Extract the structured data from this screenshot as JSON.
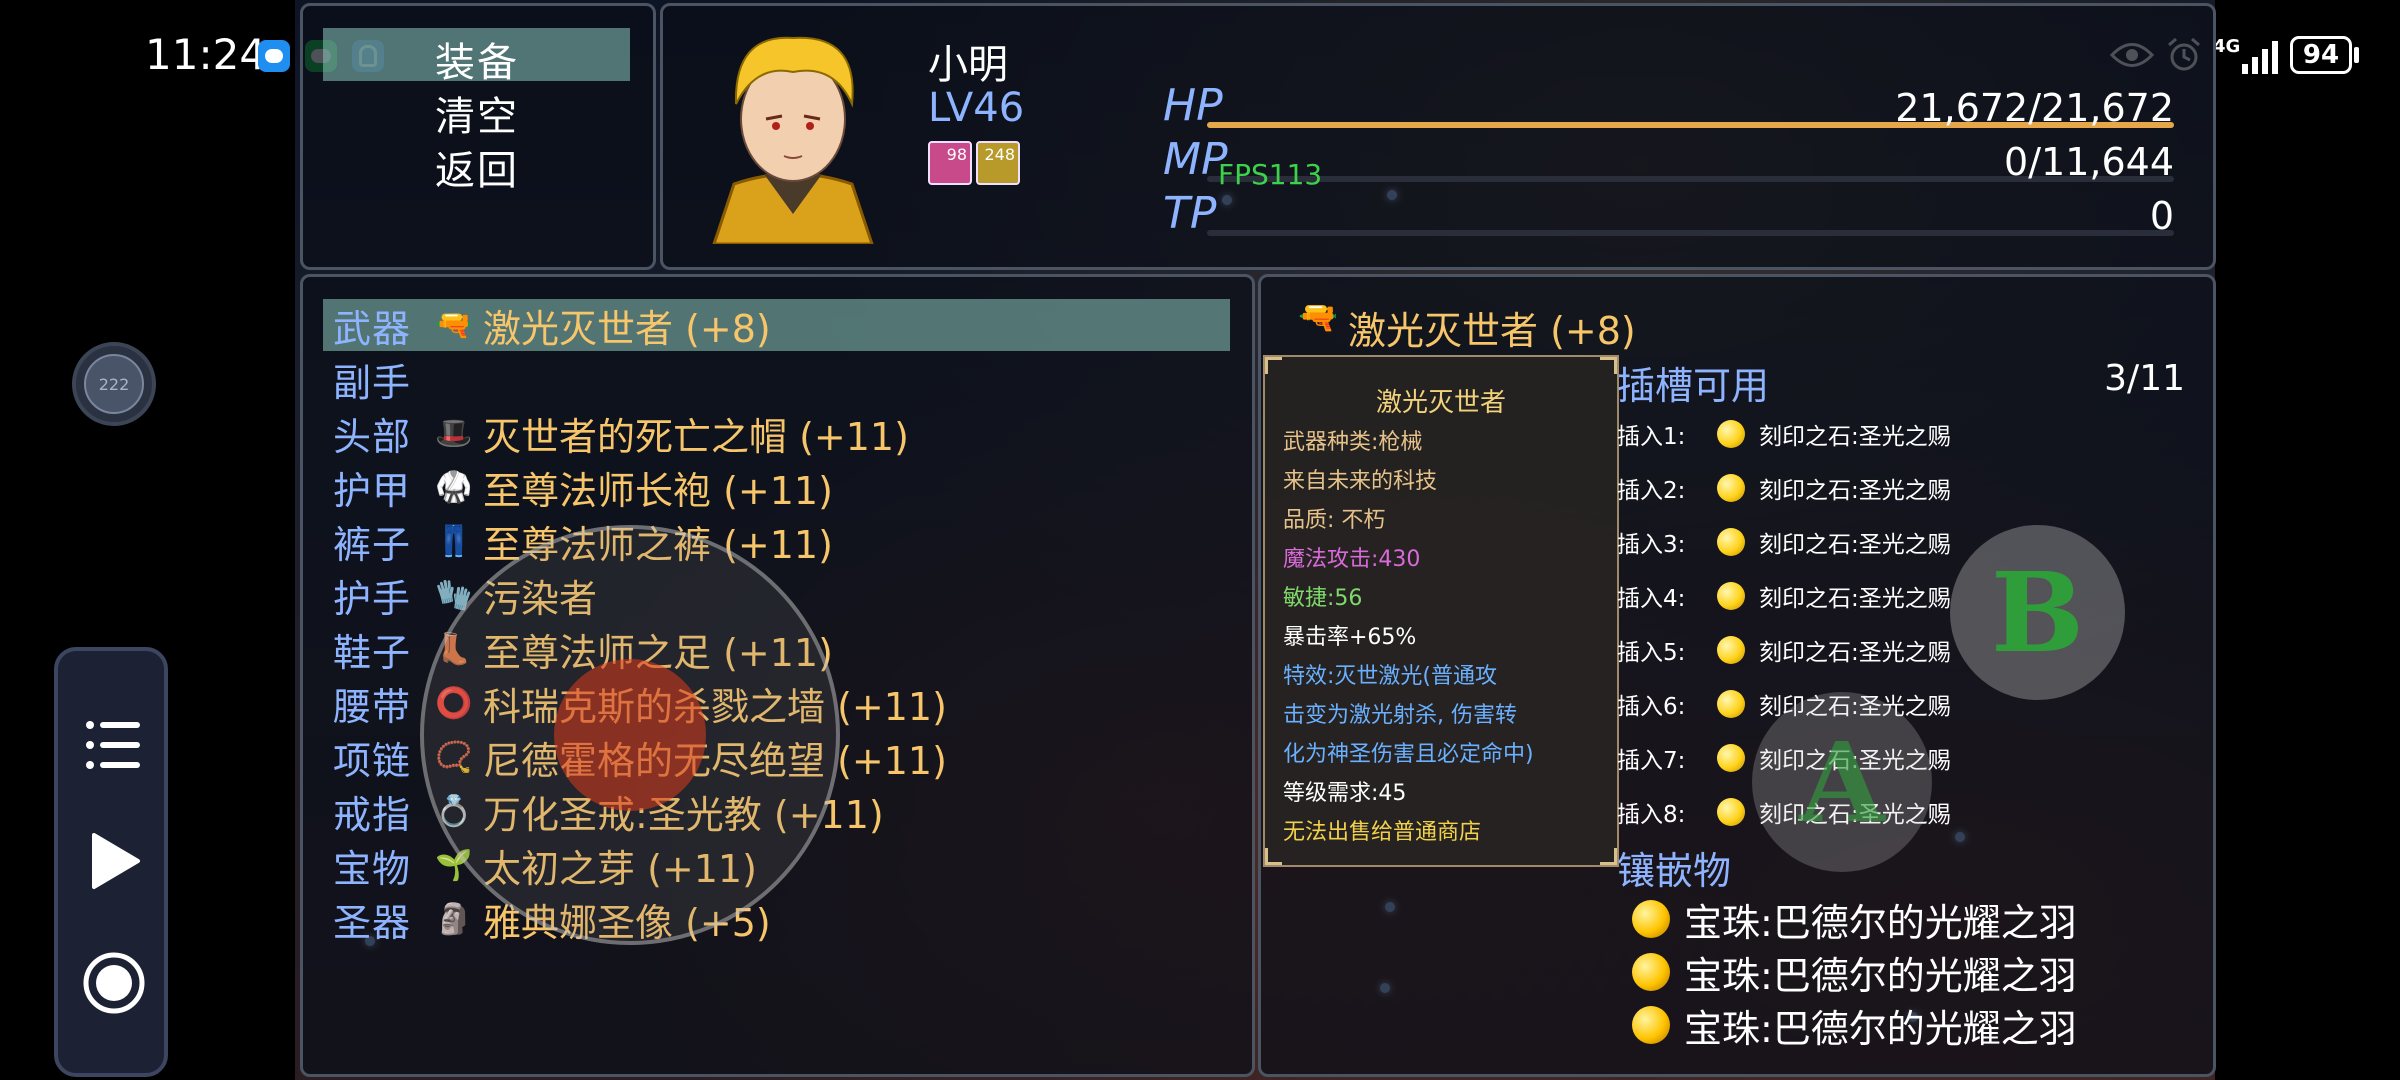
{
  "status_bar": {
    "time": "11:24",
    "network": "4G",
    "battery": "94"
  },
  "command_menu": {
    "items": [
      "装备",
      "清空",
      "返回"
    ],
    "selected_index": 0
  },
  "actor": {
    "name": "小明",
    "level": "LV46",
    "badges": [
      "98",
      "248"
    ],
    "hp": {
      "label": "HP",
      "value": "21,672/21,672",
      "ratio": 1.0,
      "color": "#e6a64a"
    },
    "mp": {
      "label": "MP",
      "value": "0/11,644",
      "ratio": 0.0,
      "color": "#4a62c8"
    },
    "tp": {
      "label": "TP",
      "value": "0",
      "ratio": 0.0,
      "color": "#4a62c8"
    }
  },
  "fps_text": "FPS113",
  "float_button_text": "222",
  "equipment_slots": [
    {
      "slot": "武器",
      "icon": "laser-gun-icon",
      "glyph": "🔫",
      "name": "激光灭世者 (+8)"
    },
    {
      "slot": "副手",
      "icon": "",
      "glyph": "",
      "name": ""
    },
    {
      "slot": "头部",
      "icon": "red-hat-icon",
      "glyph": "🎩",
      "name": "灭世者的死亡之帽 (+11)"
    },
    {
      "slot": "护甲",
      "icon": "robe-icon",
      "glyph": "🥋",
      "name": "至尊法师长袍 (+11)"
    },
    {
      "slot": "裤子",
      "icon": "pants-icon",
      "glyph": "👖",
      "name": "至尊法师之裤 (+11)"
    },
    {
      "slot": "护手",
      "icon": "gauntlet-icon",
      "glyph": "🧤",
      "name": "污染者"
    },
    {
      "slot": "鞋子",
      "icon": "boot-icon",
      "glyph": "👢",
      "name": "至尊法师之足 (+11)"
    },
    {
      "slot": "腰带",
      "icon": "belt-icon",
      "glyph": "⭕",
      "name": "科瑞克斯的杀戮之墙 (+11)"
    },
    {
      "slot": "项链",
      "icon": "necklace-icon",
      "glyph": "📿",
      "name": "尼德霍格的无尽绝望 (+11)"
    },
    {
      "slot": "戒指",
      "icon": "ring-icon",
      "glyph": "💍",
      "name": "万化圣戒:圣光教 (+11)"
    },
    {
      "slot": "宝物",
      "icon": "sprout-icon",
      "glyph": "🌱",
      "name": "太初之芽 (+11)"
    },
    {
      "slot": "圣器",
      "icon": "statue-icon",
      "glyph": "🗿",
      "name": "雅典娜圣像 (+5)"
    }
  ],
  "detail": {
    "item_title": "激光灭世者 (+8)",
    "tooltip": {
      "name": "激光灭世者",
      "lines": [
        {
          "text": "武器种类:枪械",
          "color": "#e6c28a"
        },
        {
          "text": "来自未来的科技",
          "color": "#e6c28a"
        },
        {
          "text": "品质: 不朽",
          "color": "#e6c28a"
        },
        {
          "text": "魔法攻击:430",
          "color": "#d96ad9"
        },
        {
          "text": "敏捷:56",
          "color": "#7fd96a"
        },
        {
          "text": "暴击率+65%",
          "color": "#ffffff"
        },
        {
          "text": "特效:灭世激光(普通攻",
          "color": "#6ab0ff"
        },
        {
          "text": "击变为激光射杀, 伤害转",
          "color": "#6ab0ff"
        },
        {
          "text": "化为神圣伤害且必定命中)",
          "color": "#6ab0ff"
        },
        {
          "text": "等级需求:45",
          "color": "#ffffff"
        },
        {
          "text": "无法出售给普通商店",
          "color": "#f2d24a"
        }
      ]
    },
    "sockets_title": "插槽可用",
    "sockets_count": "3/11",
    "sockets": [
      {
        "label": "插入1:",
        "item": "刻印之石:圣光之赐"
      },
      {
        "label": "插入2:",
        "item": "刻印之石:圣光之赐"
      },
      {
        "label": "插入3:",
        "item": "刻印之石:圣光之赐"
      },
      {
        "label": "插入4:",
        "item": "刻印之石:圣光之赐"
      },
      {
        "label": "插入5:",
        "item": "刻印之石:圣光之赐"
      },
      {
        "label": "插入6:",
        "item": "刻印之石:圣光之赐"
      },
      {
        "label": "插入7:",
        "item": "刻印之石:圣光之赐"
      },
      {
        "label": "插入8:",
        "item": "刻印之石:圣光之赐"
      }
    ],
    "inlay_title": "镶嵌物",
    "inlays": [
      "宝珠:巴德尔的光耀之羽",
      "宝珠:巴德尔的光耀之羽",
      "宝珠:巴德尔的光耀之羽"
    ]
  },
  "virtual_buttons": {
    "b": "B",
    "a": "A"
  }
}
